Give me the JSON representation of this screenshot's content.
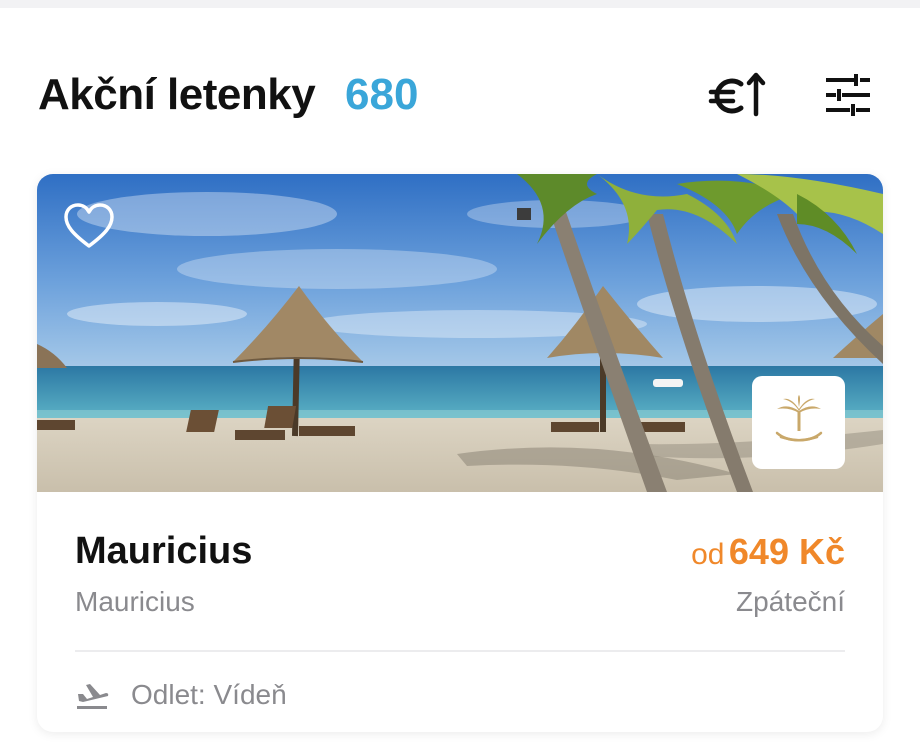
{
  "header": {
    "title": "Akční letenky",
    "count": "680",
    "sort_icon": "euro-sort-ascending-icon",
    "filter_icon": "sliders-filter-icon"
  },
  "card": {
    "favorite_icon": "heart-outline-icon",
    "airline_logo": "saudia-palm-swords-logo",
    "destination": "Mauricius",
    "country": "Mauricius",
    "price_prefix": "od",
    "price": "649 Kč",
    "trip_type": "Zpáteční",
    "departure_icon": "plane-departure-icon",
    "departure": "Odlet: Vídeň"
  },
  "colors": {
    "count": "#3aa6d9",
    "price": "#f0882a",
    "muted_text": "#8a8a8e",
    "logo_gold": "#c9a86a"
  }
}
